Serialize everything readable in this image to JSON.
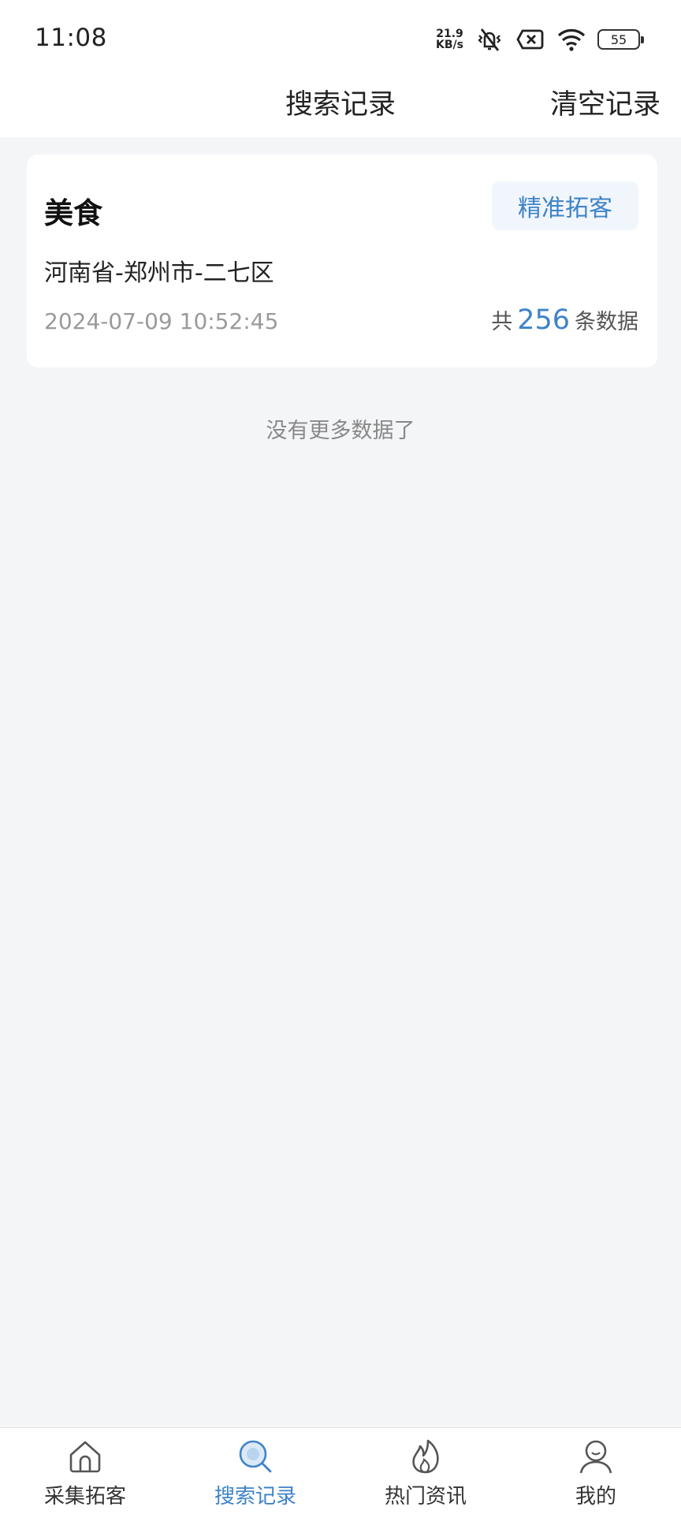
{
  "status_bar": {
    "time": "11:08",
    "net_speed_value": "21.9",
    "net_speed_unit": "KB/s",
    "battery": "55",
    "icons": [
      "vibrate-mute-icon",
      "sim-blocked-icon",
      "wifi-icon",
      "battery-icon"
    ]
  },
  "header": {
    "title": "搜索记录",
    "clear_label": "清空记录"
  },
  "records": [
    {
      "keyword": "美食",
      "action_label": "精准拓客",
      "region": "河南省-郑州市-二七区",
      "time": "2024-07-09 10:52:45",
      "count_prefix": "共",
      "count": "256",
      "count_suffix": "条数据"
    }
  ],
  "footer_text": "没有更多数据了",
  "tabs": [
    {
      "label": "采集拓客",
      "icon": "home-icon",
      "active": false
    },
    {
      "label": "搜索记录",
      "icon": "search-icon",
      "active": true
    },
    {
      "label": "热门资讯",
      "icon": "fire-icon",
      "active": false
    },
    {
      "label": "我的",
      "icon": "user-icon",
      "active": false
    }
  ],
  "colors": {
    "accent": "#3f83c9",
    "background": "#f4f5f7",
    "button_bg": "#f1f6fc"
  }
}
